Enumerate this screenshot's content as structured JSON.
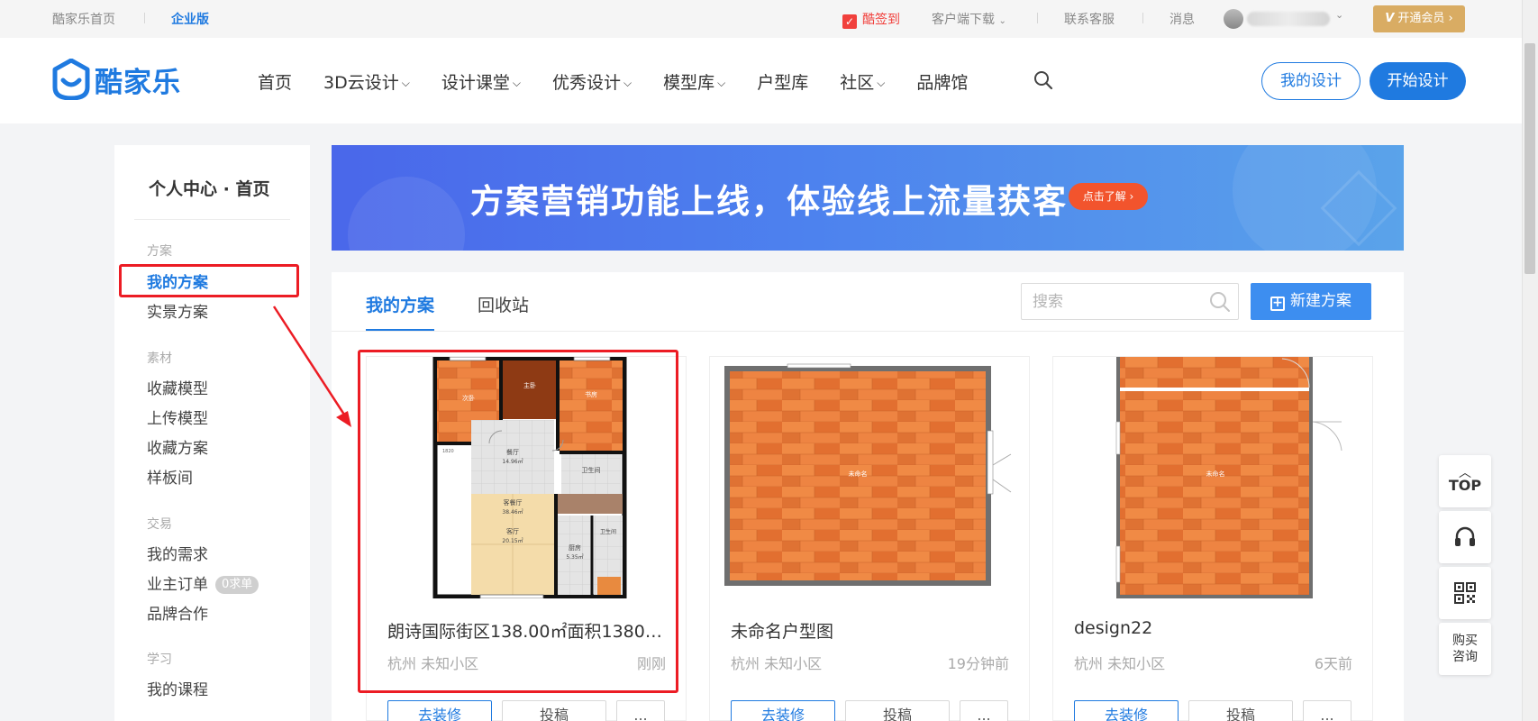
{
  "colors": {
    "primary": "#1f7ae0",
    "vip": "#d9ac63",
    "annotation_red": "#ec1c24",
    "checkin_red": "#f1403c",
    "banner_start": "#4a67ea",
    "banner_end": "#5aa3ea"
  },
  "topbar": {
    "home_link": "酷家乐首页",
    "enterprise": "企业版",
    "checkin": "酷签到",
    "client_download": "客户端下载",
    "customer_service": "联系客服",
    "messages": "消息",
    "vip_button": "开通会员"
  },
  "header": {
    "logo_text": "酷家乐",
    "nav": [
      {
        "label": "首页",
        "dropdown": false
      },
      {
        "label": "3D云设计",
        "dropdown": true
      },
      {
        "label": "设计课堂",
        "dropdown": true
      },
      {
        "label": "优秀设计",
        "dropdown": true
      },
      {
        "label": "模型库",
        "dropdown": true
      },
      {
        "label": "户型库",
        "dropdown": false
      },
      {
        "label": "社区",
        "dropdown": true
      },
      {
        "label": "品牌馆",
        "dropdown": false
      }
    ],
    "my_design_button": "我的设计",
    "start_design_button": "开始设计"
  },
  "sidebar": {
    "title": "个人中心 · 首页",
    "groups": {
      "plan": "方案",
      "material": "素材",
      "trade": "交易",
      "study": "学习"
    },
    "items": {
      "my_plans": "我的方案",
      "live_plans": "实景方案",
      "fav_models": "收藏模型",
      "upload_models": "上传模型",
      "fav_plans": "收藏方案",
      "showroom": "样板间",
      "my_demands": "我的需求",
      "owner_orders": "业主订单",
      "owner_orders_badge": "0求单",
      "brand_coop": "品牌合作",
      "my_courses": "我的课程"
    }
  },
  "banner": {
    "text": "方案营销功能上线，体验线上流量获客",
    "button": "点击了解 ›"
  },
  "main": {
    "tabs": [
      "我的方案",
      "回收站"
    ],
    "search_placeholder": "搜索",
    "new_button": "新建方案",
    "cards": [
      {
        "name": "朗诗国际街区138.00㎡面积13800...",
        "location": "杭州 未知小区",
        "time": "刚刚",
        "actions": [
          "去装修",
          "投稿",
          "..."
        ],
        "plan_labels": {
          "room_a": "次卧",
          "room_b": "主卧",
          "room_c": "书房",
          "dining": "餐厅",
          "dining_area": "14.96㎡",
          "bath1": "卫生间",
          "living_dining": "客餐厅",
          "living_dining_area": "38.46㎡",
          "living": "客厅",
          "living_area": "20.15㎡",
          "kitchen": "厨房",
          "kitchen_area": "5.35㎡",
          "bath2": "卫生间",
          "dim_left": "1820"
        }
      },
      {
        "name": "未命名户型图",
        "location": "杭州 未知小区",
        "time": "19分钟前",
        "actions": [
          "去装修",
          "投稿",
          "..."
        ],
        "plan_labels": {
          "room": "未命名"
        }
      },
      {
        "name": "design22",
        "location": "杭州 未知小区",
        "time": "6天前",
        "actions": [
          "去装修",
          "投稿",
          "..."
        ],
        "plan_labels": {
          "room": "未命名"
        }
      }
    ]
  },
  "float_tools": {
    "top": "TOP",
    "buy_line1": "购买",
    "buy_line2": "咨询"
  }
}
